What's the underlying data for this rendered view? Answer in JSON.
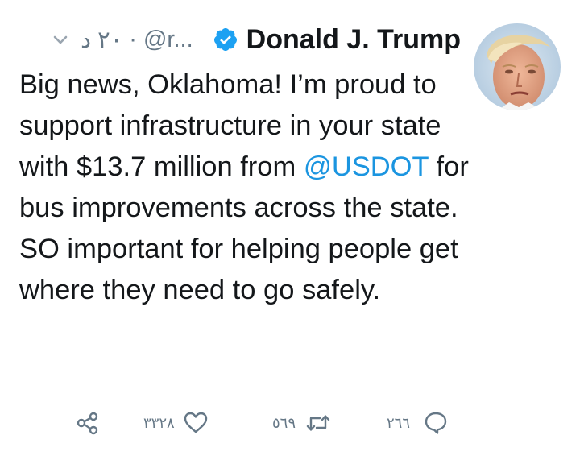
{
  "tweet": {
    "author_name": "Donald J. Trump",
    "handle": "@r...",
    "separator": "·",
    "time": "٢٠ د",
    "text_before": "Big news, Oklahoma! I’m proud to support infrastructure in your state with $13.7 million from ",
    "mention": "@USDOT",
    "text_after": " for bus improvements across the state. SO important for helping people get where they need to go safely.",
    "likes": "٣٣٢٨",
    "retweets": "٥٦٩",
    "replies": "٢٦٦"
  },
  "icons": {
    "menu": "chevron-down-icon",
    "verified": "verified-badge-icon",
    "share": "share-icon",
    "like": "heart-icon",
    "retweet": "retweet-icon",
    "reply": "reply-icon"
  },
  "colors": {
    "verified": "#1da1f2",
    "mention": "#1b95e0",
    "icon": "#657786"
  }
}
